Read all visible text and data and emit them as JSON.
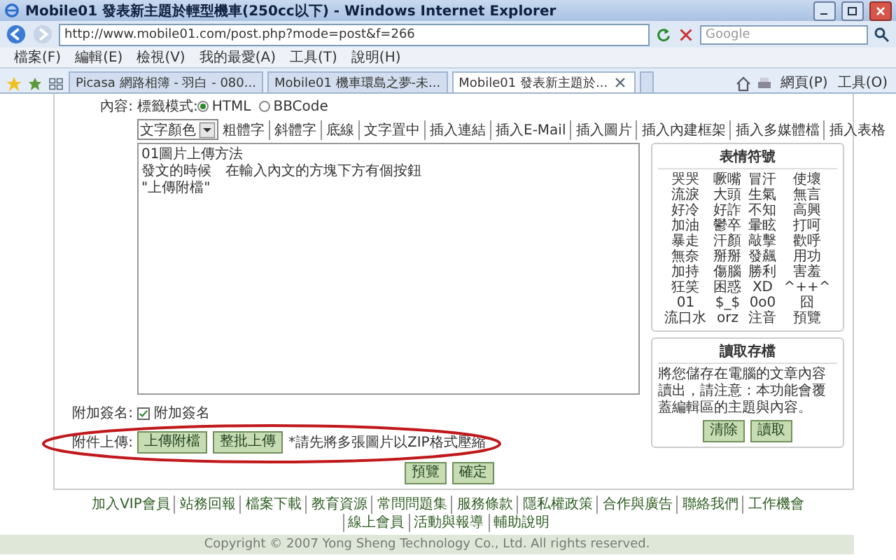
{
  "window": {
    "title": "Mobile01 發表新主題於輕型機車(250cc以下) - Windows Internet Explorer"
  },
  "address_bar": {
    "url": "http://www.mobile01.com/post.php?mode=post&f=266"
  },
  "search": {
    "placeholder": "Google"
  },
  "menu": [
    "檔案(F)",
    "編輯(E)",
    "檢視(V)",
    "我的最愛(A)",
    "工具(T)",
    "說明(H)"
  ],
  "tabs": [
    {
      "label": "Picasa 網路相簿 - 羽白 - 080...",
      "selected": false
    },
    {
      "label": "Mobile01 機車環島之夢-未...",
      "selected": false
    },
    {
      "label": "Mobile01 發表新主題於...",
      "selected": true
    }
  ],
  "command_bar": [
    "網頁(P)",
    "工具(O)"
  ],
  "form": {
    "content_label": "內容:",
    "tag_mode": {
      "label": "標籤模式:",
      "options": [
        {
          "label": "HTML",
          "selected": true
        },
        {
          "label": "BBCode",
          "selected": false
        }
      ]
    },
    "color_select": "文字顏色",
    "format_links": [
      "粗體字",
      "斜體字",
      "底線",
      "文字置中",
      "插入連結",
      "插入E-Mail",
      "插入圖片",
      "插入內建框架",
      "插入多媒體檔",
      "插入表格"
    ],
    "editor": {
      "lines": [
        "01圖片上傳方法",
        "發文的時候　在輸入內文的方塊下方有個按鈕",
        "\"上傳附檔\""
      ]
    },
    "emoticons": {
      "title": "表情符號",
      "items": [
        "哭哭",
        "噘嘴",
        "冒汗",
        "使壞",
        "流淚",
        "大頭",
        "生氣",
        "無言",
        "好冷",
        "好詐",
        "不知",
        "高興",
        "加油",
        "鬱卒",
        "暈眩",
        "打呵",
        "暴走",
        "汗顏",
        "敲擊",
        "歡呼",
        "無奈",
        "掰掰",
        "發飆",
        "用功",
        "加持",
        "傷腦",
        "勝利",
        "害羞",
        "狂笑",
        "困惑",
        "XD",
        "^++^",
        "01",
        "$_$",
        "0o0",
        "囧",
        "流口水",
        "orz",
        "注音",
        "預覽"
      ]
    },
    "load_save": {
      "title": "讀取存檔",
      "text": "將您儲存在電腦的文章內容讀出，請注意：本功能會覆蓋編輯區的主題與內容。",
      "buttons": [
        "清除",
        "讀取"
      ]
    },
    "signature": {
      "label": "附加簽名:",
      "option": "附加簽名",
      "checked": true
    },
    "attachments": {
      "label": "附件上傳:",
      "buttons": [
        "上傳附檔",
        "整批上傳"
      ],
      "note": "*請先將多張圖片以ZIP格式壓縮",
      "highlighted": true
    },
    "actions": [
      "預覽",
      "確定"
    ]
  },
  "footer": {
    "links": [
      "加入VIP會員",
      "站務回報",
      "檔案下載",
      "教育資源",
      "常問問題集",
      "服務條款",
      "隱私權政策",
      "合作與廣告",
      "聯絡我們",
      "工作機會",
      "線上會員",
      "活動與報導",
      "輔助說明"
    ],
    "copyright": "Copyright © 2007 Yong Sheng Technology Co., Ltd. All rights reserved."
  }
}
